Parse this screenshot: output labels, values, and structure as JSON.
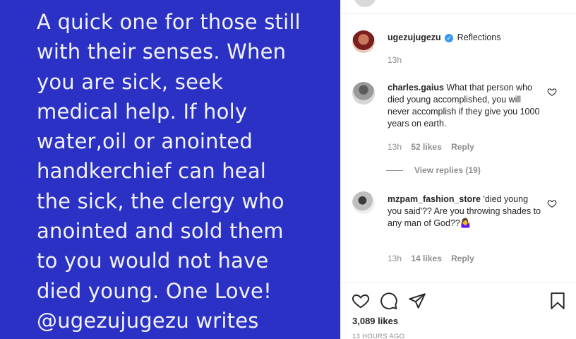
{
  "image_text": [
    "A quick one for those still",
    "with their senses. When",
    "you are sick, seek",
    "medical help. If holy",
    "water,oil or anointed",
    "handkerchief can heal",
    "the sick, the clergy who",
    "anointed and sold them",
    "to you would not have",
    "died young. One Love!",
    "@ugezujugezu writes"
  ],
  "caption": {
    "username": "ugezujugezu",
    "text": "Reflections",
    "time": "13h"
  },
  "comments": [
    {
      "username": "charles.gaius",
      "text": "What that person who died young accomplished, you will never accomplish if they give you 1000 years on earth.",
      "time": "13h",
      "likes": "52 likes",
      "reply": "Reply",
      "view_replies": "View replies (19)"
    },
    {
      "username": "mzpam_fashion_store",
      "text": "'died young you said'?? Are you throwing shades to any man of God??🤷‍♀️",
      "time": "13h",
      "likes": "14 likes",
      "reply": "Reply"
    }
  ],
  "post": {
    "likes": "3,089 likes",
    "time_ago": "13 HOURS AGO"
  },
  "icons": {
    "like": "heart-icon",
    "comment": "comment-bubble-icon",
    "share": "paper-plane-icon",
    "save": "bookmark-icon",
    "verified": "verified-badge-icon"
  },
  "colors": {
    "image_background": "#2a31c4",
    "image_text": "#f2f2f8",
    "verified": "#3897f0",
    "muted": "#8e8e8e"
  }
}
